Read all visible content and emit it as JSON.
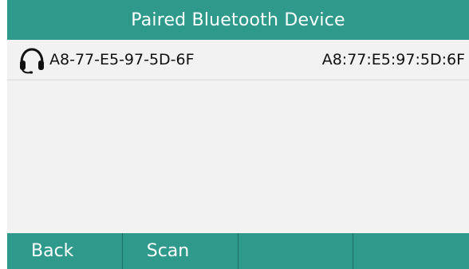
{
  "header": {
    "title": "Paired Bluetooth Device"
  },
  "devices": [
    {
      "icon": "headset-icon",
      "name": "A8-77-E5-97-5D-6F",
      "mac": "A8:77:E5:97:5D:6F"
    }
  ],
  "softkeys": [
    {
      "label": "Back"
    },
    {
      "label": "Scan"
    },
    {
      "label": ""
    },
    {
      "label": ""
    }
  ],
  "colors": {
    "accent": "#2f9a8c",
    "background": "#f2f2f2",
    "text": "#111111"
  }
}
